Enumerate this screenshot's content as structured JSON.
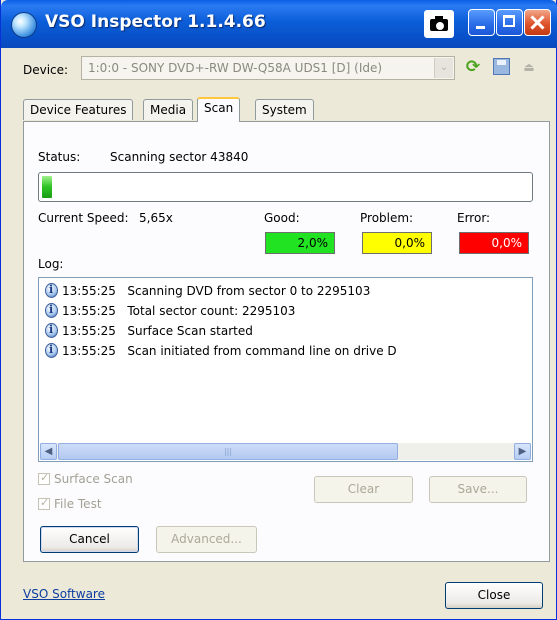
{
  "window": {
    "title": "VSO Inspector 1.1.4.66"
  },
  "titlebar_icons": {
    "camera": "camera-icon",
    "minimize": "minimize-icon",
    "maximize": "maximize-icon",
    "close": "close-icon"
  },
  "device": {
    "label": "Device:",
    "value": "1:0:0 - SONY DVD+-RW DW-Q58A UDS1 [D] (Ide)",
    "dropdown_glyph": "⌄",
    "refresh_glyph": "⟳",
    "eject_glyph": "⏏"
  },
  "tabs": [
    {
      "label": "Device Features",
      "active": false
    },
    {
      "label": "Media",
      "active": false
    },
    {
      "label": "Scan",
      "active": true
    },
    {
      "label": "System",
      "active": false
    }
  ],
  "scan": {
    "status_label": "Status:",
    "status_text": "Scanning sector 43840",
    "progress_fraction": 0.02,
    "speed_label": "Current Speed:",
    "speed_value": "5,65x",
    "good_label": "Good:",
    "good_value": "2,0%",
    "problem_label": "Problem:",
    "problem_value": "0,0%",
    "error_label": "Error:",
    "error_value": "0,0%",
    "colors": {
      "good": "#22e322",
      "problem": "#ffff00",
      "error": "#ff0000"
    },
    "log_label": "Log:",
    "log": [
      {
        "time": "13:55:25",
        "message": "Scanning DVD from sector 0 to 2295103"
      },
      {
        "time": "13:55:25",
        "message": "Total sector count: 2295103"
      },
      {
        "time": "13:55:25",
        "message": "Surface Scan started"
      },
      {
        "time": "13:55:25",
        "message": "Scan initiated from command line on drive D"
      }
    ],
    "scroll": {
      "left": "◀",
      "right": "▶",
      "grip": "|||"
    },
    "surface_scan_label": "Surface Scan",
    "file_test_label": "File Test",
    "clear_label": "Clear",
    "save_label": "Save...",
    "cancel_label": "Cancel",
    "advanced_label": "Advanced..."
  },
  "footer": {
    "link": "VSO Software",
    "close_label": "Close"
  }
}
